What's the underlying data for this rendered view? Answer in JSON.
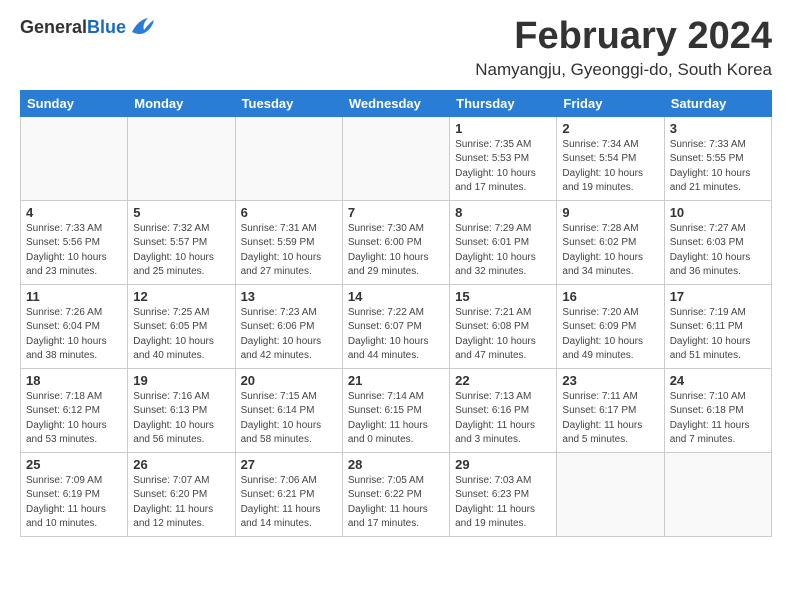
{
  "header": {
    "logo_general": "General",
    "logo_blue": "Blue",
    "title": "February 2024",
    "subtitle": "Namyangju, Gyeonggi-do, South Korea"
  },
  "days_of_week": [
    "Sunday",
    "Monday",
    "Tuesday",
    "Wednesday",
    "Thursday",
    "Friday",
    "Saturday"
  ],
  "weeks": [
    [
      {
        "day": "",
        "info": ""
      },
      {
        "day": "",
        "info": ""
      },
      {
        "day": "",
        "info": ""
      },
      {
        "day": "",
        "info": ""
      },
      {
        "day": "1",
        "info": "Sunrise: 7:35 AM\nSunset: 5:53 PM\nDaylight: 10 hours\nand 17 minutes."
      },
      {
        "day": "2",
        "info": "Sunrise: 7:34 AM\nSunset: 5:54 PM\nDaylight: 10 hours\nand 19 minutes."
      },
      {
        "day": "3",
        "info": "Sunrise: 7:33 AM\nSunset: 5:55 PM\nDaylight: 10 hours\nand 21 minutes."
      }
    ],
    [
      {
        "day": "4",
        "info": "Sunrise: 7:33 AM\nSunset: 5:56 PM\nDaylight: 10 hours\nand 23 minutes."
      },
      {
        "day": "5",
        "info": "Sunrise: 7:32 AM\nSunset: 5:57 PM\nDaylight: 10 hours\nand 25 minutes."
      },
      {
        "day": "6",
        "info": "Sunrise: 7:31 AM\nSunset: 5:59 PM\nDaylight: 10 hours\nand 27 minutes."
      },
      {
        "day": "7",
        "info": "Sunrise: 7:30 AM\nSunset: 6:00 PM\nDaylight: 10 hours\nand 29 minutes."
      },
      {
        "day": "8",
        "info": "Sunrise: 7:29 AM\nSunset: 6:01 PM\nDaylight: 10 hours\nand 32 minutes."
      },
      {
        "day": "9",
        "info": "Sunrise: 7:28 AM\nSunset: 6:02 PM\nDaylight: 10 hours\nand 34 minutes."
      },
      {
        "day": "10",
        "info": "Sunrise: 7:27 AM\nSunset: 6:03 PM\nDaylight: 10 hours\nand 36 minutes."
      }
    ],
    [
      {
        "day": "11",
        "info": "Sunrise: 7:26 AM\nSunset: 6:04 PM\nDaylight: 10 hours\nand 38 minutes."
      },
      {
        "day": "12",
        "info": "Sunrise: 7:25 AM\nSunset: 6:05 PM\nDaylight: 10 hours\nand 40 minutes."
      },
      {
        "day": "13",
        "info": "Sunrise: 7:23 AM\nSunset: 6:06 PM\nDaylight: 10 hours\nand 42 minutes."
      },
      {
        "day": "14",
        "info": "Sunrise: 7:22 AM\nSunset: 6:07 PM\nDaylight: 10 hours\nand 44 minutes."
      },
      {
        "day": "15",
        "info": "Sunrise: 7:21 AM\nSunset: 6:08 PM\nDaylight: 10 hours\nand 47 minutes."
      },
      {
        "day": "16",
        "info": "Sunrise: 7:20 AM\nSunset: 6:09 PM\nDaylight: 10 hours\nand 49 minutes."
      },
      {
        "day": "17",
        "info": "Sunrise: 7:19 AM\nSunset: 6:11 PM\nDaylight: 10 hours\nand 51 minutes."
      }
    ],
    [
      {
        "day": "18",
        "info": "Sunrise: 7:18 AM\nSunset: 6:12 PM\nDaylight: 10 hours\nand 53 minutes."
      },
      {
        "day": "19",
        "info": "Sunrise: 7:16 AM\nSunset: 6:13 PM\nDaylight: 10 hours\nand 56 minutes."
      },
      {
        "day": "20",
        "info": "Sunrise: 7:15 AM\nSunset: 6:14 PM\nDaylight: 10 hours\nand 58 minutes."
      },
      {
        "day": "21",
        "info": "Sunrise: 7:14 AM\nSunset: 6:15 PM\nDaylight: 11 hours\nand 0 minutes."
      },
      {
        "day": "22",
        "info": "Sunrise: 7:13 AM\nSunset: 6:16 PM\nDaylight: 11 hours\nand 3 minutes."
      },
      {
        "day": "23",
        "info": "Sunrise: 7:11 AM\nSunset: 6:17 PM\nDaylight: 11 hours\nand 5 minutes."
      },
      {
        "day": "24",
        "info": "Sunrise: 7:10 AM\nSunset: 6:18 PM\nDaylight: 11 hours\nand 7 minutes."
      }
    ],
    [
      {
        "day": "25",
        "info": "Sunrise: 7:09 AM\nSunset: 6:19 PM\nDaylight: 11 hours\nand 10 minutes."
      },
      {
        "day": "26",
        "info": "Sunrise: 7:07 AM\nSunset: 6:20 PM\nDaylight: 11 hours\nand 12 minutes."
      },
      {
        "day": "27",
        "info": "Sunrise: 7:06 AM\nSunset: 6:21 PM\nDaylight: 11 hours\nand 14 minutes."
      },
      {
        "day": "28",
        "info": "Sunrise: 7:05 AM\nSunset: 6:22 PM\nDaylight: 11 hours\nand 17 minutes."
      },
      {
        "day": "29",
        "info": "Sunrise: 7:03 AM\nSunset: 6:23 PM\nDaylight: 11 hours\nand 19 minutes."
      },
      {
        "day": "",
        "info": ""
      },
      {
        "day": "",
        "info": ""
      }
    ]
  ]
}
